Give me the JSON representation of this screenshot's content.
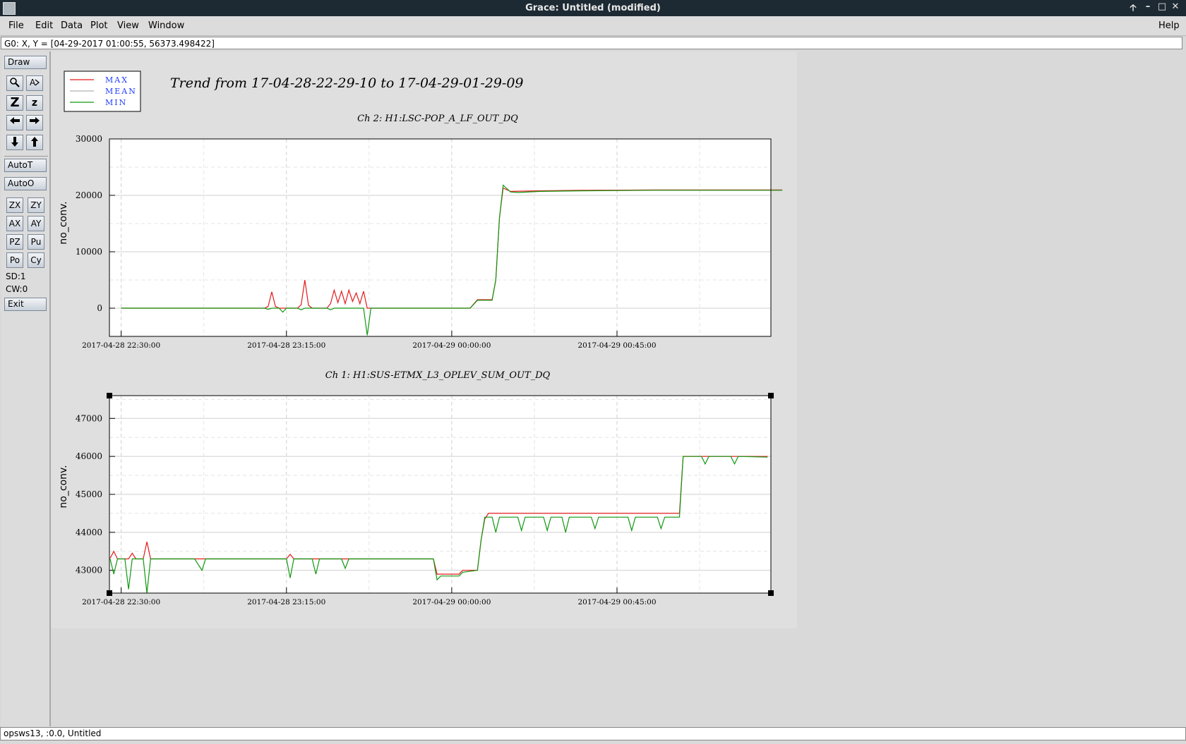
{
  "window": {
    "title": "Grace: Untitled (modified)",
    "buttons": [
      "🡡",
      "–",
      "□",
      "✕"
    ]
  },
  "menubar": {
    "items": [
      "File",
      "Edit",
      "Data",
      "Plot",
      "View",
      "Window"
    ],
    "help": "Help"
  },
  "locator": {
    "text": "G0: X, Y = [04-29-2017 01:00:55, 56373.498422]"
  },
  "toolbar": {
    "draw_label": "Draw",
    "autot_label": "AutoT",
    "autoo_label": "AutoO",
    "zx": "ZX",
    "zy": "ZY",
    "ax": "AX",
    "ay": "AY",
    "pz": "PZ",
    "pu": "Pu",
    "po": "Po",
    "cy": "Cy",
    "sd": "SD:1",
    "cw": "CW:0",
    "exit_label": "Exit",
    "zoom_icon_glyph": "Z",
    "zoom_small_glyph": "z"
  },
  "statusbar": {
    "text": "opsws13, :0.0, Untitled"
  },
  "plot": {
    "title": "Trend from 17-04-28-22-29-10 to 17-04-29-01-29-09",
    "legend": [
      {
        "label": "MAX",
        "color": "#e31a1c"
      },
      {
        "label": "MEAN",
        "color": "#b0b0b0"
      },
      {
        "label": "MIN",
        "color": "#119911"
      }
    ]
  },
  "chart_data": [
    {
      "type": "line",
      "title": "Ch 2: H1:LSC-POP_A_LF_OUT_DQ",
      "ylabel": "no_conv.",
      "xlabel": "",
      "x_ticks": [
        "2017-04-28 22:30:00",
        "2017-04-28 23:15:00",
        "2017-04-29 00:00:00",
        "2017-04-29 00:45:00"
      ],
      "xlim_minutes": [
        -3.2,
        176.9
      ],
      "y_ticks": [
        0,
        10000,
        20000,
        30000
      ],
      "ylim": [
        -5000,
        30000
      ],
      "grid": true,
      "series": [
        {
          "name": "MAX",
          "color": "#e31a1c",
          "points": [
            [
              0,
              0
            ],
            [
              39,
              0
            ],
            [
              40,
              300
            ],
            [
              41,
              2900
            ],
            [
              42,
              300
            ],
            [
              43,
              0
            ],
            [
              48,
              0
            ],
            [
              49,
              600
            ],
            [
              50,
              5000
            ],
            [
              51,
              500
            ],
            [
              52,
              0
            ],
            [
              56,
              0
            ],
            [
              57,
              800
            ],
            [
              58,
              3200
            ],
            [
              59,
              1000
            ],
            [
              60,
              3000
            ],
            [
              61,
              800
            ],
            [
              62,
              3200
            ],
            [
              63,
              1200
            ],
            [
              64,
              2700
            ],
            [
              65,
              800
            ],
            [
              66,
              3000
            ],
            [
              67,
              0
            ],
            [
              82,
              0
            ],
            [
              88,
              0
            ],
            [
              89,
              0
            ],
            [
              90,
              0
            ],
            [
              91,
              0
            ],
            [
              95,
              0
            ],
            [
              97,
              1500
            ],
            [
              101,
              1500
            ],
            [
              102,
              5000
            ],
            [
              103,
              16000
            ],
            [
              104,
              21300
            ],
            [
              106,
              20700
            ],
            [
              114,
              20800
            ],
            [
              125,
              20900
            ],
            [
              145,
              20950
            ],
            [
              180,
              20950
            ]
          ]
        },
        {
          "name": "MIN",
          "color": "#119911",
          "points": [
            [
              0,
              0
            ],
            [
              39,
              0
            ],
            [
              40,
              -200
            ],
            [
              41,
              0
            ],
            [
              43,
              0
            ],
            [
              44,
              -700
            ],
            [
              45,
              0
            ],
            [
              48,
              0
            ],
            [
              49,
              -300
            ],
            [
              50,
              0
            ],
            [
              56,
              0
            ],
            [
              57,
              -300
            ],
            [
              58,
              0
            ],
            [
              66,
              0
            ],
            [
              67,
              -4800
            ],
            [
              68,
              0
            ],
            [
              82,
              0
            ],
            [
              88,
              0
            ],
            [
              89,
              0
            ],
            [
              90,
              0
            ],
            [
              91,
              0
            ],
            [
              95,
              0
            ],
            [
              97,
              1400
            ],
            [
              101,
              1400
            ],
            [
              102,
              5000
            ],
            [
              103,
              16000
            ],
            [
              104,
              21800
            ],
            [
              106,
              20600
            ],
            [
              108,
              20500
            ],
            [
              114,
              20700
            ],
            [
              125,
              20800
            ],
            [
              145,
              20900
            ],
            [
              180,
              20900
            ]
          ]
        }
      ]
    },
    {
      "type": "line",
      "title": "Ch 1: H1:SUS-ETMX_L3_OPLEV_SUM_OUT_DQ",
      "ylabel": "no_conv.",
      "xlabel": "",
      "x_ticks": [
        "2017-04-28 22:30:00",
        "2017-04-28 23:15:00",
        "2017-04-29 00:00:00",
        "2017-04-29 00:45:00"
      ],
      "xlim_minutes": [
        -3.2,
        176.9
      ],
      "y_ticks": [
        43000,
        44000,
        45000,
        46000,
        47000
      ],
      "ylim": [
        42400,
        47600
      ],
      "grid": true,
      "series": [
        {
          "name": "MAX",
          "color": "#e31a1c",
          "points": [
            [
              -3,
              43320
            ],
            [
              -2,
              43500
            ],
            [
              -1,
              43300
            ],
            [
              2,
              43300
            ],
            [
              3,
              43450
            ],
            [
              4,
              43300
            ],
            [
              6,
              43300
            ],
            [
              7,
              43750
            ],
            [
              8,
              43300
            ],
            [
              20,
              43300
            ],
            [
              45,
              43300
            ],
            [
              46,
              43420
            ],
            [
              47,
              43300
            ],
            [
              80,
              43300
            ],
            [
              85,
              43300
            ],
            [
              86,
              42900
            ],
            [
              92,
              42900
            ],
            [
              93,
              43000
            ],
            [
              97,
              43000
            ],
            [
              98,
              43800
            ],
            [
              99,
              44350
            ],
            [
              100,
              44500
            ],
            [
              120,
              44500
            ],
            [
              152,
              44500
            ],
            [
              153,
              46000
            ],
            [
              176,
              46000
            ]
          ]
        },
        {
          "name": "MIN",
          "color": "#119911",
          "points": [
            [
              -3,
              43300
            ],
            [
              -2,
              42900
            ],
            [
              -1,
              43300
            ],
            [
              1,
              43300
            ],
            [
              2,
              42500
            ],
            [
              3,
              43300
            ],
            [
              6,
              43300
            ],
            [
              7,
              42400
            ],
            [
              8,
              43300
            ],
            [
              20,
              43300
            ],
            [
              22,
              43000
            ],
            [
              23,
              43300
            ],
            [
              45,
              43300
            ],
            [
              46,
              42800
            ],
            [
              47,
              43300
            ],
            [
              52,
              43300
            ],
            [
              53,
              42900
            ],
            [
              54,
              43300
            ],
            [
              60,
              43300
            ],
            [
              61,
              43050
            ],
            [
              62,
              43300
            ],
            [
              85,
              43300
            ],
            [
              86,
              42750
            ],
            [
              87,
              42850
            ],
            [
              92,
              42850
            ],
            [
              93,
              42950
            ],
            [
              97,
              43000
            ],
            [
              98,
              43800
            ],
            [
              99,
              44400
            ],
            [
              101,
              44400
            ],
            [
              102,
              44000
            ],
            [
              103,
              44400
            ],
            [
              108,
              44400
            ],
            [
              109,
              44050
            ],
            [
              110,
              44400
            ],
            [
              115,
              44400
            ],
            [
              116,
              44050
            ],
            [
              117,
              44400
            ],
            [
              120,
              44400
            ],
            [
              121,
              44000
            ],
            [
              122,
              44400
            ],
            [
              128,
              44400
            ],
            [
              129,
              44100
            ],
            [
              130,
              44400
            ],
            [
              138,
              44400
            ],
            [
              139,
              44050
            ],
            [
              140,
              44400
            ],
            [
              146,
              44400
            ],
            [
              147,
              44100
            ],
            [
              148,
              44400
            ],
            [
              152,
              44400
            ],
            [
              153,
              46000
            ],
            [
              158,
              46000
            ],
            [
              159,
              45800
            ],
            [
              160,
              46000
            ],
            [
              166,
              46000
            ],
            [
              167,
              45800
            ],
            [
              168,
              46000
            ],
            [
              176,
              45980
            ]
          ]
        }
      ]
    }
  ]
}
